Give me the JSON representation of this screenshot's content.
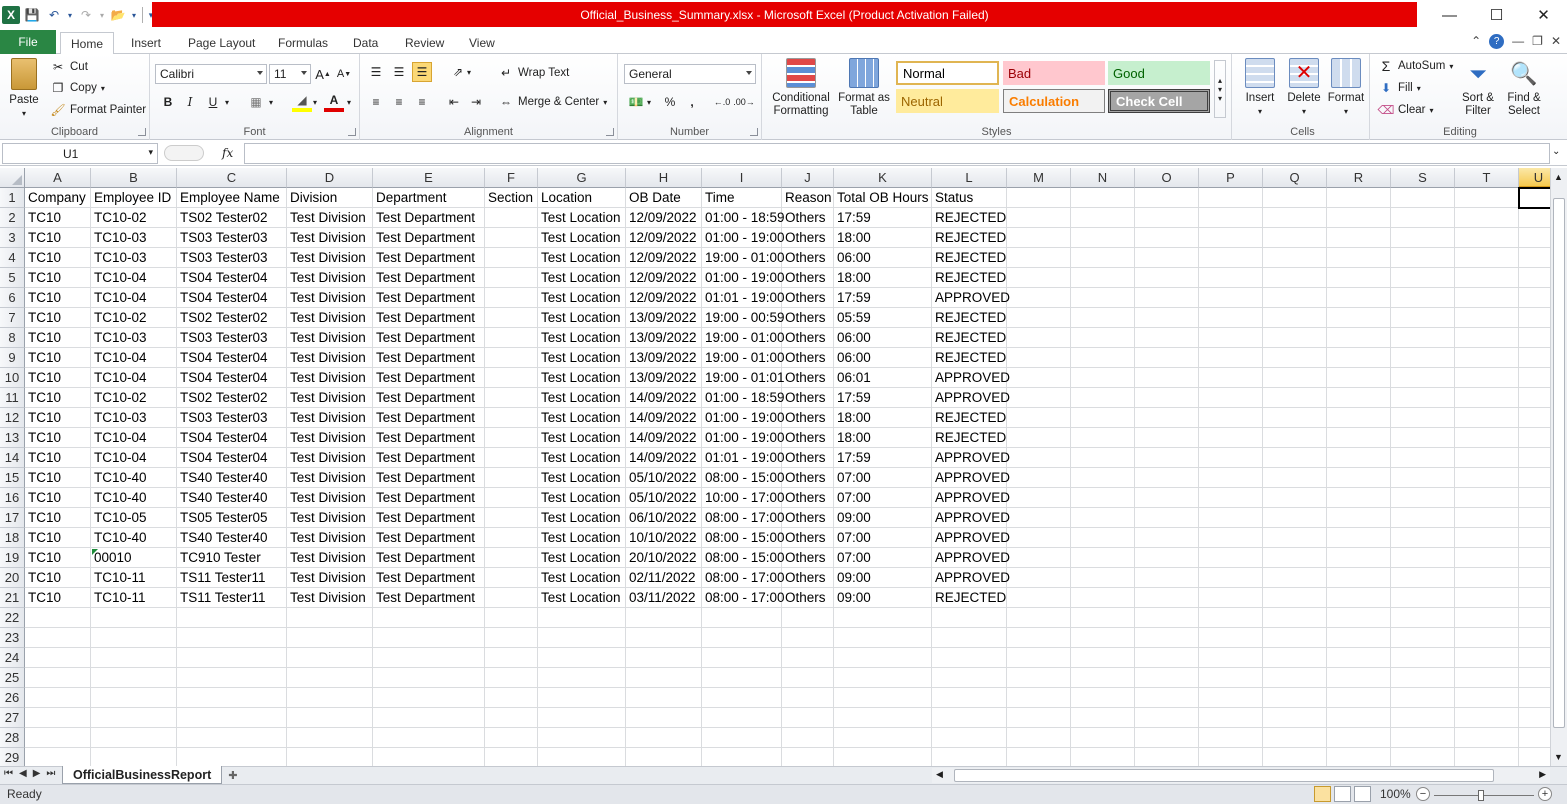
{
  "window": {
    "title": "Official_Business_Summary.xlsx  -  Microsoft Excel (Product Activation Failed)"
  },
  "tabs": [
    "File",
    "Home",
    "Insert",
    "Page Layout",
    "Formulas",
    "Data",
    "Review",
    "View"
  ],
  "ribbon": {
    "clipboard": {
      "label": "Clipboard",
      "paste": "Paste",
      "cut": "Cut",
      "copy": "Copy",
      "format_painter": "Format Painter"
    },
    "font": {
      "label": "Font",
      "name": "Calibri",
      "size": "11"
    },
    "alignment": {
      "label": "Alignment",
      "wrap": "Wrap Text",
      "merge": "Merge & Center"
    },
    "number": {
      "label": "Number",
      "format": "General"
    },
    "styles": {
      "label": "Styles",
      "conditional": "Conditional Formatting",
      "format_table": "Format as Table",
      "normal": "Normal",
      "bad": "Bad",
      "good": "Good",
      "neutral": "Neutral",
      "calculation": "Calculation",
      "check_cell": "Check Cell"
    },
    "cells": {
      "label": "Cells",
      "insert": "Insert",
      "delete": "Delete",
      "format": "Format"
    },
    "editing": {
      "label": "Editing",
      "autosum": "AutoSum",
      "fill": "Fill",
      "clear": "Clear",
      "sort": "Sort & Filter",
      "find": "Find & Select"
    }
  },
  "formula_bar": {
    "name_box": "U1",
    "fx": "fx",
    "value": ""
  },
  "columns": [
    "A",
    "B",
    "C",
    "D",
    "E",
    "F",
    "G",
    "H",
    "I",
    "J",
    "K",
    "L",
    "M",
    "N",
    "O",
    "P",
    "Q",
    "R",
    "S",
    "T"
  ],
  "selected_column": "U",
  "row_numbers": [
    "1",
    "2",
    "3",
    "4",
    "5",
    "6",
    "7",
    "8",
    "9",
    "10",
    "11",
    "12",
    "13",
    "14",
    "15",
    "16",
    "17",
    "18",
    "19",
    "20",
    "21",
    "22",
    "23",
    "24",
    "25",
    "26",
    "27",
    "28",
    "29"
  ],
  "header_row": [
    "Company",
    "Employee ID",
    "Employee Name",
    "Division",
    "Department",
    "Section",
    "Location",
    "OB Date",
    "Time",
    "Reason",
    "Total OB Hours",
    "Status"
  ],
  "rows": [
    [
      "TC10",
      "TC10-02",
      "TS02 Tester02",
      "Test Division",
      "Test Department",
      "",
      "Test Location",
      "12/09/2022",
      "01:00 - 18:59",
      "Others",
      "17:59",
      "REJECTED"
    ],
    [
      "TC10",
      "TC10-03",
      "TS03 Tester03",
      "Test Division",
      "Test Department",
      "",
      "Test Location",
      "12/09/2022",
      "01:00 - 19:00",
      "Others",
      "18:00",
      "REJECTED"
    ],
    [
      "TC10",
      "TC10-03",
      "TS03 Tester03",
      "Test Division",
      "Test Department",
      "",
      "Test Location",
      "12/09/2022",
      "19:00 - 01:00",
      "Others",
      "06:00",
      "REJECTED"
    ],
    [
      "TC10",
      "TC10-04",
      "TS04 Tester04",
      "Test Division",
      "Test Department",
      "",
      "Test Location",
      "12/09/2022",
      "01:00 - 19:00",
      "Others",
      "18:00",
      "REJECTED"
    ],
    [
      "TC10",
      "TC10-04",
      "TS04 Tester04",
      "Test Division",
      "Test Department",
      "",
      "Test Location",
      "12/09/2022",
      "01:01 - 19:00",
      "Others",
      "17:59",
      "APPROVED"
    ],
    [
      "TC10",
      "TC10-02",
      "TS02 Tester02",
      "Test Division",
      "Test Department",
      "",
      "Test Location",
      "13/09/2022",
      "19:00 - 00:59",
      "Others",
      "05:59",
      "REJECTED"
    ],
    [
      "TC10",
      "TC10-03",
      "TS03 Tester03",
      "Test Division",
      "Test Department",
      "",
      "Test Location",
      "13/09/2022",
      "19:00 - 01:00",
      "Others",
      "06:00",
      "REJECTED"
    ],
    [
      "TC10",
      "TC10-04",
      "TS04 Tester04",
      "Test Division",
      "Test Department",
      "",
      "Test Location",
      "13/09/2022",
      "19:00 - 01:00",
      "Others",
      "06:00",
      "REJECTED"
    ],
    [
      "TC10",
      "TC10-04",
      "TS04 Tester04",
      "Test Division",
      "Test Department",
      "",
      "Test Location",
      "13/09/2022",
      "19:00 - 01:01",
      "Others",
      "06:01",
      "APPROVED"
    ],
    [
      "TC10",
      "TC10-02",
      "TS02 Tester02",
      "Test Division",
      "Test Department",
      "",
      "Test Location",
      "14/09/2022",
      "01:00 - 18:59",
      "Others",
      "17:59",
      "APPROVED"
    ],
    [
      "TC10",
      "TC10-03",
      "TS03 Tester03",
      "Test Division",
      "Test Department",
      "",
      "Test Location",
      "14/09/2022",
      "01:00 - 19:00",
      "Others",
      "18:00",
      "REJECTED"
    ],
    [
      "TC10",
      "TC10-04",
      "TS04 Tester04",
      "Test Division",
      "Test Department",
      "",
      "Test Location",
      "14/09/2022",
      "01:00 - 19:00",
      "Others",
      "18:00",
      "REJECTED"
    ],
    [
      "TC10",
      "TC10-04",
      "TS04 Tester04",
      "Test Division",
      "Test Department",
      "",
      "Test Location",
      "14/09/2022",
      "01:01 - 19:00",
      "Others",
      "17:59",
      "APPROVED"
    ],
    [
      "TC10",
      "TC10-40",
      "TS40 Tester40",
      "Test Division",
      "Test Department",
      "",
      "Test Location",
      "05/10/2022",
      "08:00 - 15:00",
      "Others",
      "07:00",
      "APPROVED"
    ],
    [
      "TC10",
      "TC10-40",
      "TS40 Tester40",
      "Test Division",
      "Test Department",
      "",
      "Test Location",
      "05/10/2022",
      "10:00 - 17:00",
      "Others",
      "07:00",
      "APPROVED"
    ],
    [
      "TC10",
      "TC10-05",
      "TS05 Tester05",
      "Test Division",
      "Test Department",
      "",
      "Test Location",
      "06/10/2022",
      "08:00 - 17:00",
      "Others",
      "09:00",
      "APPROVED"
    ],
    [
      "TC10",
      "TC10-40",
      "TS40 Tester40",
      "Test Division",
      "Test Department",
      "",
      "Test Location",
      "10/10/2022",
      "08:00 - 15:00",
      "Others",
      "07:00",
      "APPROVED"
    ],
    [
      "TC10",
      "00010",
      "TC910 Tester",
      "Test Division",
      "Test Department",
      "",
      "Test Location",
      "20/10/2022",
      "08:00 - 15:00",
      "Others",
      "07:00",
      "APPROVED"
    ],
    [
      "TC10",
      "TC10-11",
      "TS11 Tester11",
      "Test Division",
      "Test Department",
      "",
      "Test Location",
      "02/11/2022",
      "08:00 - 17:00",
      "Others",
      "09:00",
      "APPROVED"
    ],
    [
      "TC10",
      "TC10-11",
      "TS11 Tester11",
      "Test Division",
      "Test Department",
      "",
      "Test Location",
      "03/11/2022",
      "08:00 - 17:00",
      "Others",
      "09:00",
      "REJECTED"
    ]
  ],
  "sheet_tab": "OfficialBusinessReport",
  "status": {
    "ready": "Ready",
    "zoom": "100%"
  },
  "colors": {
    "title_bar": "#e50000",
    "file_tab": "#2a8644",
    "selected_header": "#f6c94f"
  }
}
